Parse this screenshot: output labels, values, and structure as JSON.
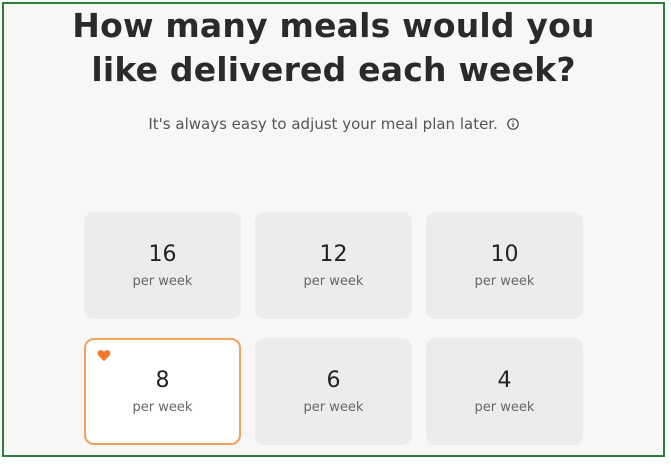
{
  "heading": {
    "line1": "How many meals would you",
    "line2": "like delivered each week?"
  },
  "subtitle": "It's always easy to adjust your meal plan later.",
  "colors": {
    "selected_border": "#f0a25e",
    "heart": "#f07a2a",
    "tile_bg": "#ececea"
  },
  "options": [
    {
      "count": "16",
      "unit": "per week"
    },
    {
      "count": "12",
      "unit": "per week"
    },
    {
      "count": "10",
      "unit": "per week"
    },
    {
      "count": "8",
      "unit": "per week",
      "selected": true,
      "icon": "heart-icon"
    },
    {
      "count": "6",
      "unit": "per week"
    },
    {
      "count": "4",
      "unit": "per week"
    }
  ]
}
